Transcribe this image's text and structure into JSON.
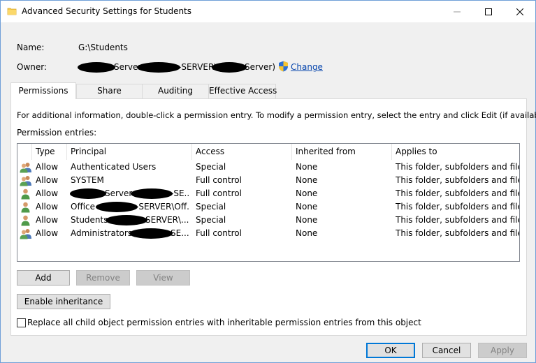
{
  "window": {
    "title": "Advanced Security Settings for Students",
    "folder_icon": "folder-icon",
    "minimize_icon": "minimize-icon",
    "maximize_icon": "maximize-icon",
    "close_icon": "close-icon"
  },
  "info": {
    "name_label": "Name:",
    "name_value": "G:\\Students",
    "owner_label": "Owner:",
    "owner_part1": "Server",
    "owner_part2": "-SERVER\\",
    "owner_part3": "Server)",
    "change_link": "Change",
    "shield_icon": "uac-shield-icon"
  },
  "tabs": [
    "Permissions",
    "Share",
    "Auditing",
    "Effective Access"
  ],
  "panel": {
    "info_text": "For additional information, double-click a permission entry. To modify a permission entry, select the entry and click Edit (if available).",
    "entries_label": "Permission entries:"
  },
  "table": {
    "headers": [
      "Type",
      "Principal",
      "Access",
      "Inherited from",
      "Applies to"
    ],
    "rows": [
      {
        "icon": "group-icon",
        "type": "Allow",
        "principal": "Authenticated Users",
        "access": "Special",
        "inherited": "None",
        "applies": "This folder, subfolders and files"
      },
      {
        "icon": "group-icon",
        "type": "Allow",
        "principal": "SYSTEM",
        "access": "Full control",
        "inherited": "None",
        "applies": "This folder, subfolders and files"
      },
      {
        "icon": "user-icon",
        "type": "Allow",
        "principal_a": "Server",
        "principal_b": "-SE...",
        "access": "Full control",
        "inherited": "None",
        "applies": "This folder, subfolders and files"
      },
      {
        "icon": "user-icon",
        "type": "Allow",
        "principal_a": "Office",
        "principal_b": "-SERVER\\Off...",
        "access": "Special",
        "inherited": "None",
        "applies": "This folder, subfolders and files"
      },
      {
        "icon": "user-icon",
        "type": "Allow",
        "principal_a": "Students",
        "principal_b": "SERVER\\...",
        "access": "Special",
        "inherited": "None",
        "applies": "This folder, subfolders and files"
      },
      {
        "icon": "group-icon",
        "type": "Allow",
        "principal_a": "Administrators",
        "principal_b": "SE...",
        "access": "Full control",
        "inherited": "None",
        "applies": "This folder, subfolders and files"
      }
    ]
  },
  "buttons": {
    "add": "Add",
    "remove": "Remove",
    "view": "View",
    "enable_inheritance": "Enable inheritance",
    "ok": "OK",
    "cancel": "Cancel",
    "apply": "Apply"
  },
  "replace_checkbox": {
    "checked": false,
    "label": "Replace all child object permission entries with inheritable permission entries from this object"
  }
}
